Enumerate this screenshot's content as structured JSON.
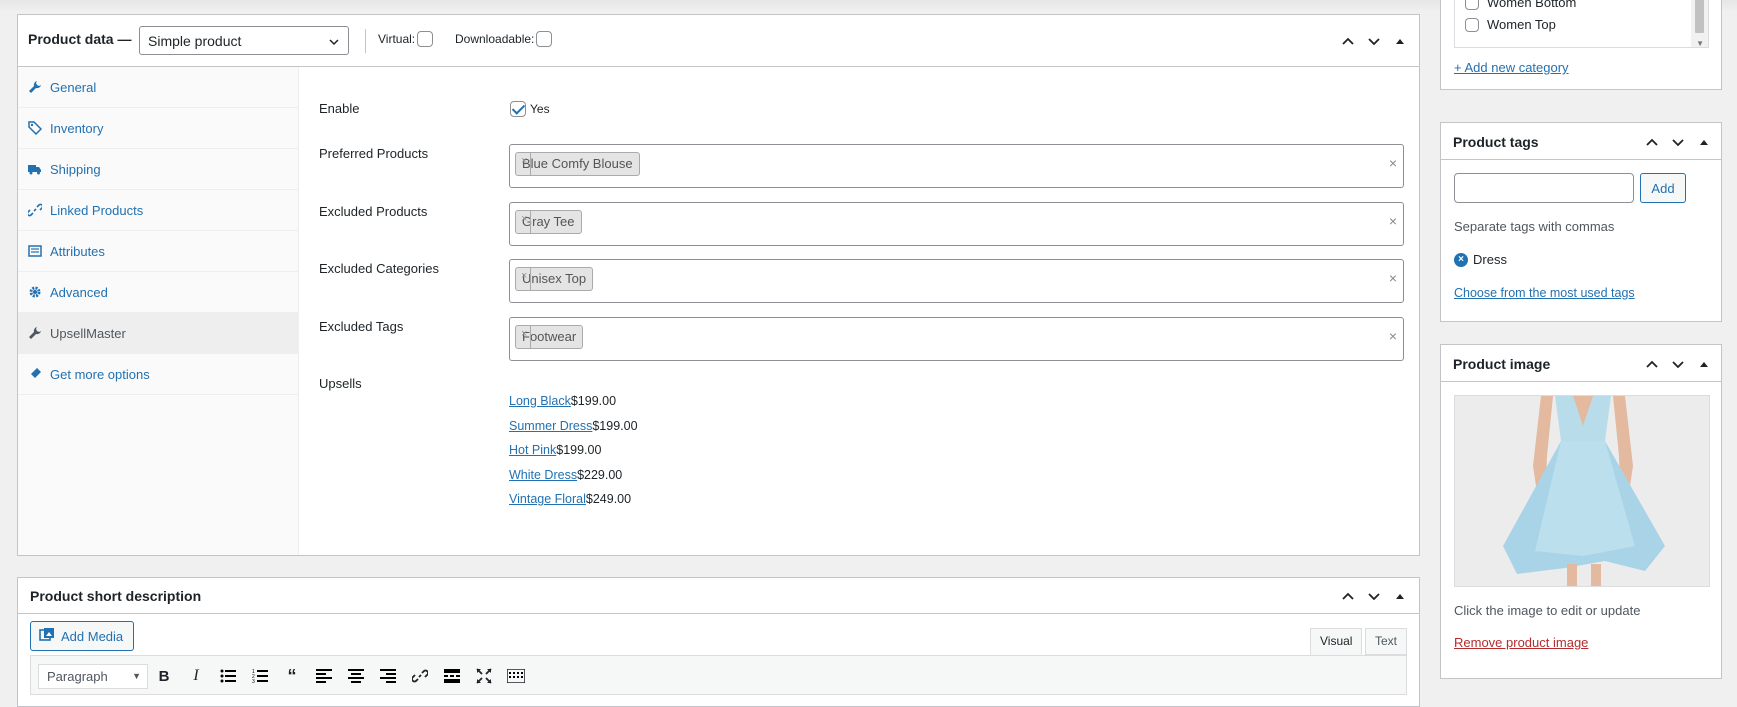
{
  "product_data": {
    "title": "Product data —",
    "product_type": "Simple product",
    "virtual_label": "Virtual:",
    "downloadable_label": "Downloadable:",
    "tabs": [
      {
        "label": "General",
        "icon": "wrench-icon"
      },
      {
        "label": "Inventory",
        "icon": "tag-icon"
      },
      {
        "label": "Shipping",
        "icon": "truck-icon"
      },
      {
        "label": "Linked Products",
        "icon": "link-icon"
      },
      {
        "label": "Attributes",
        "icon": "list-icon"
      },
      {
        "label": "Advanced",
        "icon": "gear-icon"
      },
      {
        "label": "UpsellMaster",
        "icon": "wrench-icon"
      },
      {
        "label": "Get more options",
        "icon": "plugin-icon"
      }
    ],
    "active_tab": "UpsellMaster",
    "fields": {
      "enable_label": "Enable",
      "enable_value": "Yes",
      "preferred_label": "Preferred Products",
      "preferred_chip": "Blue Comfy Blouse",
      "excluded_products_label": "Excluded Products",
      "excluded_products_chip": "Gray Tee",
      "excluded_categories_label": "Excluded Categories",
      "excluded_categories_chip": "Unisex Top",
      "excluded_tags_label": "Excluded Tags",
      "excluded_tags_chip": "Footwear",
      "upsells_label": "Upsells",
      "remove_glyph": "×",
      "clear_glyph": "×"
    },
    "upsells": [
      {
        "name": "Long Black",
        "price": "$199.00"
      },
      {
        "name": "Summer Dress",
        "price": "$199.00"
      },
      {
        "name": "Hot Pink",
        "price": "$199.00"
      },
      {
        "name": "White Dress",
        "price": "$229.00"
      },
      {
        "name": "Vintage Floral",
        "price": "$249.00"
      }
    ]
  },
  "short_description": {
    "title": "Product short description",
    "add_media": "Add Media",
    "visual_tab": "Visual",
    "text_tab": "Text",
    "format": "Paragraph"
  },
  "categories": {
    "items": [
      "Women Bottom",
      "Women Top"
    ],
    "add_new": "+ Add new category"
  },
  "product_tags": {
    "title": "Product tags",
    "add_button": "Add",
    "hint": "Separate tags with commas",
    "tag": "Dress",
    "choose": "Choose from the most used tags"
  },
  "product_image": {
    "title": "Product image",
    "hint": "Click the image to edit or update",
    "remove": "Remove product image"
  },
  "colors": {
    "link": "#2271b1",
    "remove": "#b32d2e",
    "border": "#c3c4c7"
  }
}
